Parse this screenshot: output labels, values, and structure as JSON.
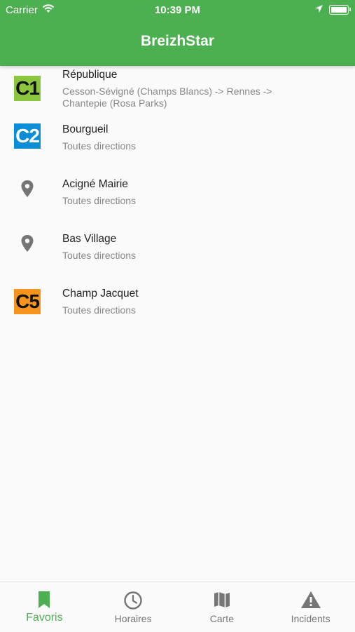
{
  "status_bar": {
    "carrier": "Carrier",
    "time": "10:39 PM"
  },
  "app_bar": {
    "title": "BreizhStar",
    "color": "#4caf50"
  },
  "favorites": [
    {
      "icon": "line-c1-badge",
      "badge_text": "C1",
      "badge_color": "#8cc63f",
      "title": "République",
      "subtitle": "Cesson-Sévigné (Champs Blancs) -> Rennes -> Chantepie (Rosa Parks)"
    },
    {
      "icon": "line-c2-badge",
      "badge_text": "C2",
      "badge_color": "#0b8ed6",
      "title": "Bourgueil",
      "subtitle": "Toutes directions"
    },
    {
      "icon": "location-pin-icon",
      "title": "Acigné Mairie",
      "subtitle": "Toutes directions"
    },
    {
      "icon": "location-pin-icon",
      "title": "Bas Village",
      "subtitle": "Toutes directions"
    },
    {
      "icon": "line-c5-badge",
      "badge_text": "C5",
      "badge_color": "#f7941d",
      "title": "Champ Jacquet",
      "subtitle": "Toutes directions"
    }
  ],
  "bottom_nav": {
    "tabs": [
      {
        "label": "Favoris",
        "icon": "bookmark-icon",
        "active": true
      },
      {
        "label": "Horaires",
        "icon": "clock-icon",
        "active": false
      },
      {
        "label": "Carte",
        "icon": "map-icon",
        "active": false
      },
      {
        "label": "Incidents",
        "icon": "warning-icon",
        "active": false
      }
    ],
    "active_color": "#4caf50",
    "inactive_color": "#777777"
  }
}
